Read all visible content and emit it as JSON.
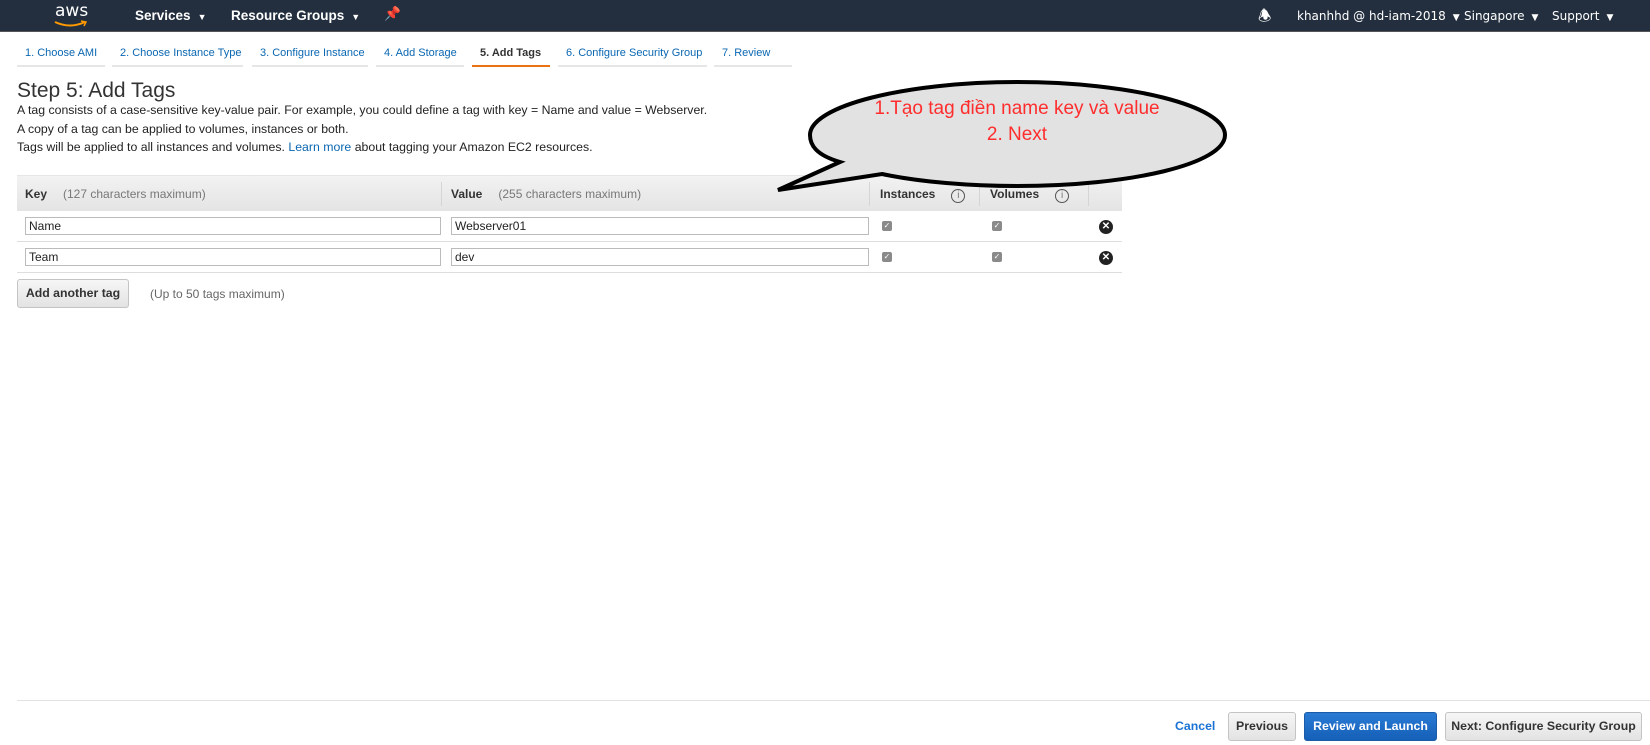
{
  "nav": {
    "logo": "aws",
    "services": "Services",
    "resource_groups": "Resource Groups",
    "user": "khanhhd @ hd-iam-2018",
    "region": "Singapore",
    "support": "Support"
  },
  "tabs": [
    {
      "label": "1. Choose AMI"
    },
    {
      "label": "2. Choose Instance Type"
    },
    {
      "label": "3. Configure Instance"
    },
    {
      "label": "4. Add Storage"
    },
    {
      "label": "5. Add Tags",
      "active": true
    },
    {
      "label": "6. Configure Security Group"
    },
    {
      "label": "7. Review"
    }
  ],
  "page": {
    "title": "Step 5: Add Tags",
    "line1": "A tag consists of a case-sensitive key-value pair. For example, you could define a tag with key = Name and value = Webserver.",
    "line2": "A copy of a tag can be applied to volumes, instances or both.",
    "line3_pre": "Tags will be applied to all instances and volumes.",
    "learn_more": "Learn more",
    "line3_post": "about tagging your Amazon EC2 resources."
  },
  "table": {
    "key": "Key",
    "key_hint": "(127 characters maximum)",
    "value": "Value",
    "value_hint": "(255 characters maximum)",
    "instances": "Instances",
    "volumes": "Volumes",
    "info": "i",
    "rows": [
      {
        "key": "Name",
        "value": "Webserver01",
        "instances": true,
        "volumes": true
      },
      {
        "key": "Team",
        "value": "dev",
        "instances": true,
        "volumes": true
      }
    ]
  },
  "add_tag": {
    "label": "Add another tag",
    "hint": "(Up to 50 tags maximum)"
  },
  "annotation": {
    "line1": "1.Tạo tag điền name key và value",
    "line2": "2. Next",
    "color": "#ff2d2d"
  },
  "footer": {
    "cancel": "Cancel",
    "previous": "Previous",
    "review": "Review and Launch",
    "next": "Next: Configure Security Group"
  }
}
